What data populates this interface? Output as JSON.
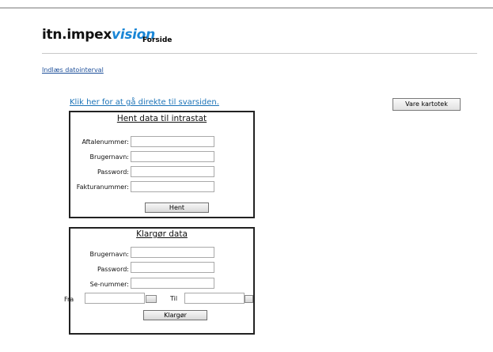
{
  "header": {
    "logo_part1": "itn.impex",
    "logo_part2": "vision",
    "nav_label": "Forside"
  },
  "links": {
    "date_interval": "Indlæs datointerval",
    "go_to_response": "Klik her for at gå direkte til svarsiden."
  },
  "buttons": {
    "vare_kartotek": "Vare kartotek"
  },
  "hent_form": {
    "title": "Hent data til intrastat",
    "fields": [
      {
        "label": "Aftalenummer:",
        "value": ""
      },
      {
        "label": "Brugernavn:",
        "value": ""
      },
      {
        "label": "Password:",
        "value": ""
      },
      {
        "label": "Fakturanummer:",
        "value": ""
      }
    ],
    "submit": "Hent"
  },
  "klargor_form": {
    "title": "Klargør data",
    "fields": [
      {
        "label": "Brugernavn:",
        "value": ""
      },
      {
        "label": "Password:",
        "value": ""
      },
      {
        "label": "Se-nummer:",
        "value": ""
      }
    ],
    "from_label": "Fra",
    "to_label": "Til",
    "submit": "Klargør"
  },
  "colors": {
    "link": "#1d4f9a",
    "logo_accent": "#1a86d6",
    "panel_border": "#222222"
  }
}
